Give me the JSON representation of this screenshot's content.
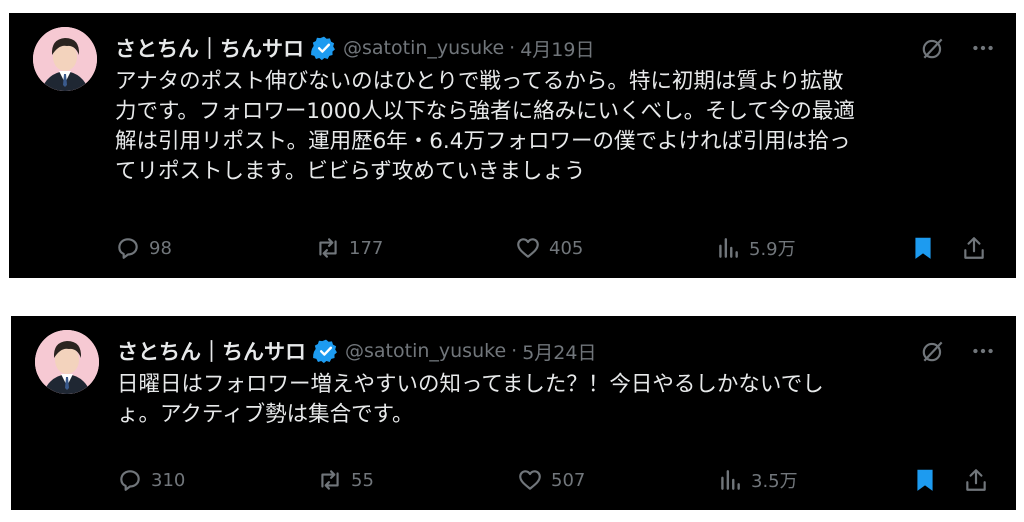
{
  "colors": {
    "card_bg": "#000000",
    "text": "#e7e9ea",
    "muted": "#71767b",
    "verified": "#1d9bf0",
    "bookmark_active": "#1d9bf0"
  },
  "tweets": [
    {
      "author_name": "さとちん｜ちんサロ",
      "handle": "@satotin_yusuke",
      "separator": "·",
      "date": "4月19日",
      "text_lines": [
        "アナタのポスト伸びないのはひとりで戦ってるから。特に初期は質より拡散",
        "力です。フォロワー1000人以下なら強者に絡みにいくべし。そして今の最適",
        "解は引用リポスト。運用歴6年・6.4万フォロワーの僕でよければ引用は拾っ",
        "てリポストします。ビビらず攻めていきましょう"
      ],
      "replies": "98",
      "reposts": "177",
      "likes": "405",
      "views": "5.9万",
      "bookmarked": true
    },
    {
      "author_name": "さとちん｜ちんサロ",
      "handle": "@satotin_yusuke",
      "separator": "·",
      "date": "5月24日",
      "text_lines": [
        "日曜日はフォロワー増えやすいの知ってました？！今日やるしかないでし",
        "ょ。アクティブ勢は集合です。"
      ],
      "replies": "310",
      "reposts": "55",
      "likes": "507",
      "views": "3.5万",
      "bookmarked": true
    }
  ],
  "icons": {
    "verified": "verified-badge-icon",
    "grok": "grok-icon",
    "more": "more-icon",
    "reply": "reply-icon",
    "repost": "repost-icon",
    "like": "like-icon",
    "views": "views-icon",
    "bookmark": "bookmark-icon",
    "share": "share-icon"
  }
}
